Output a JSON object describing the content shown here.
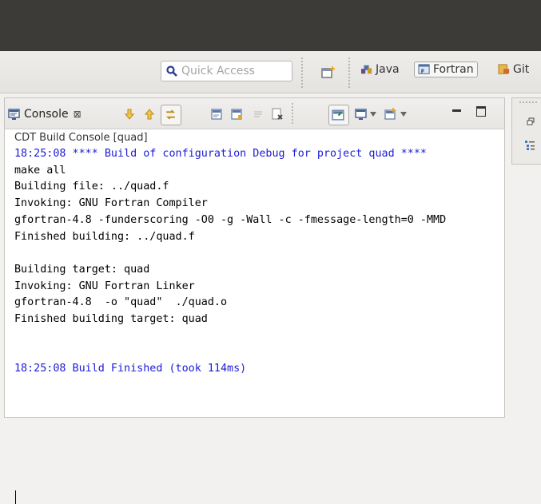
{
  "toolbar": {
    "quick_access_placeholder": "Quick Access",
    "perspectives": [
      {
        "label": "Java",
        "icon": "java-perspective-icon"
      },
      {
        "label": "Fortran",
        "icon": "fortran-perspective-icon",
        "selected": true
      },
      {
        "label": "Git",
        "icon": "git-perspective-icon"
      }
    ]
  },
  "console": {
    "tab_label": "Console",
    "tab_close_glyph": "⊠",
    "title": "CDT Build Console [quad]",
    "lines": [
      {
        "text": "18:25:08 **** Build of configuration Debug for project quad ****",
        "color": "blue"
      },
      {
        "text": "make all",
        "color": "black"
      },
      {
        "text": "Building file: ../quad.f",
        "color": "black"
      },
      {
        "text": "Invoking: GNU Fortran Compiler",
        "color": "black"
      },
      {
        "text": "gfortran-4.8 -funderscoring -O0 -g -Wall -c -fmessage-length=0 -MMD",
        "color": "black"
      },
      {
        "text": "Finished building: ../quad.f",
        "color": "black"
      },
      {
        "text": "",
        "color": "black"
      },
      {
        "text": "Building target: quad",
        "color": "black"
      },
      {
        "text": "Invoking: GNU Fortran Linker",
        "color": "black"
      },
      {
        "text": "gfortran-4.8  -o \"quad\"  ./quad.o",
        "color": "black"
      },
      {
        "text": "Finished building target: quad",
        "color": "black"
      },
      {
        "text": "",
        "color": "black"
      },
      {
        "text": "",
        "color": "black"
      },
      {
        "text": "18:25:08 Build Finished (took 114ms)",
        "color": "blue"
      }
    ]
  },
  "colors": {
    "title_bar": "#3c3b37",
    "console_blue": "#1b1bd6"
  }
}
